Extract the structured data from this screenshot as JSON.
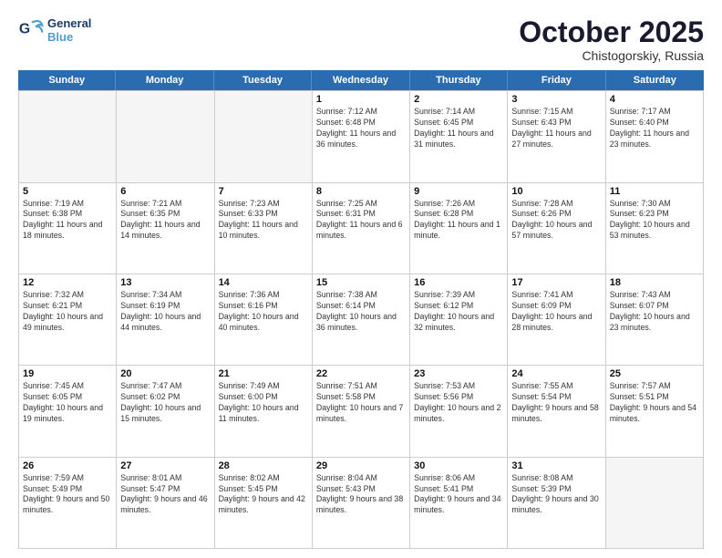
{
  "header": {
    "logo_line1": "General",
    "logo_line2": "Blue",
    "month": "October 2025",
    "location": "Chistogorskiy, Russia"
  },
  "days_of_week": [
    "Sunday",
    "Monday",
    "Tuesday",
    "Wednesday",
    "Thursday",
    "Friday",
    "Saturday"
  ],
  "weeks": [
    [
      {
        "day": "",
        "info": ""
      },
      {
        "day": "",
        "info": ""
      },
      {
        "day": "",
        "info": ""
      },
      {
        "day": "1",
        "info": "Sunrise: 7:12 AM\nSunset: 6:48 PM\nDaylight: 11 hours\nand 36 minutes."
      },
      {
        "day": "2",
        "info": "Sunrise: 7:14 AM\nSunset: 6:45 PM\nDaylight: 11 hours\nand 31 minutes."
      },
      {
        "day": "3",
        "info": "Sunrise: 7:15 AM\nSunset: 6:43 PM\nDaylight: 11 hours\nand 27 minutes."
      },
      {
        "day": "4",
        "info": "Sunrise: 7:17 AM\nSunset: 6:40 PM\nDaylight: 11 hours\nand 23 minutes."
      }
    ],
    [
      {
        "day": "5",
        "info": "Sunrise: 7:19 AM\nSunset: 6:38 PM\nDaylight: 11 hours\nand 18 minutes."
      },
      {
        "day": "6",
        "info": "Sunrise: 7:21 AM\nSunset: 6:35 PM\nDaylight: 11 hours\nand 14 minutes."
      },
      {
        "day": "7",
        "info": "Sunrise: 7:23 AM\nSunset: 6:33 PM\nDaylight: 11 hours\nand 10 minutes."
      },
      {
        "day": "8",
        "info": "Sunrise: 7:25 AM\nSunset: 6:31 PM\nDaylight: 11 hours\nand 6 minutes."
      },
      {
        "day": "9",
        "info": "Sunrise: 7:26 AM\nSunset: 6:28 PM\nDaylight: 11 hours\nand 1 minute."
      },
      {
        "day": "10",
        "info": "Sunrise: 7:28 AM\nSunset: 6:26 PM\nDaylight: 10 hours\nand 57 minutes."
      },
      {
        "day": "11",
        "info": "Sunrise: 7:30 AM\nSunset: 6:23 PM\nDaylight: 10 hours\nand 53 minutes."
      }
    ],
    [
      {
        "day": "12",
        "info": "Sunrise: 7:32 AM\nSunset: 6:21 PM\nDaylight: 10 hours\nand 49 minutes."
      },
      {
        "day": "13",
        "info": "Sunrise: 7:34 AM\nSunset: 6:19 PM\nDaylight: 10 hours\nand 44 minutes."
      },
      {
        "day": "14",
        "info": "Sunrise: 7:36 AM\nSunset: 6:16 PM\nDaylight: 10 hours\nand 40 minutes."
      },
      {
        "day": "15",
        "info": "Sunrise: 7:38 AM\nSunset: 6:14 PM\nDaylight: 10 hours\nand 36 minutes."
      },
      {
        "day": "16",
        "info": "Sunrise: 7:39 AM\nSunset: 6:12 PM\nDaylight: 10 hours\nand 32 minutes."
      },
      {
        "day": "17",
        "info": "Sunrise: 7:41 AM\nSunset: 6:09 PM\nDaylight: 10 hours\nand 28 minutes."
      },
      {
        "day": "18",
        "info": "Sunrise: 7:43 AM\nSunset: 6:07 PM\nDaylight: 10 hours\nand 23 minutes."
      }
    ],
    [
      {
        "day": "19",
        "info": "Sunrise: 7:45 AM\nSunset: 6:05 PM\nDaylight: 10 hours\nand 19 minutes."
      },
      {
        "day": "20",
        "info": "Sunrise: 7:47 AM\nSunset: 6:02 PM\nDaylight: 10 hours\nand 15 minutes."
      },
      {
        "day": "21",
        "info": "Sunrise: 7:49 AM\nSunset: 6:00 PM\nDaylight: 10 hours\nand 11 minutes."
      },
      {
        "day": "22",
        "info": "Sunrise: 7:51 AM\nSunset: 5:58 PM\nDaylight: 10 hours\nand 7 minutes."
      },
      {
        "day": "23",
        "info": "Sunrise: 7:53 AM\nSunset: 5:56 PM\nDaylight: 10 hours\nand 2 minutes."
      },
      {
        "day": "24",
        "info": "Sunrise: 7:55 AM\nSunset: 5:54 PM\nDaylight: 9 hours\nand 58 minutes."
      },
      {
        "day": "25",
        "info": "Sunrise: 7:57 AM\nSunset: 5:51 PM\nDaylight: 9 hours\nand 54 minutes."
      }
    ],
    [
      {
        "day": "26",
        "info": "Sunrise: 7:59 AM\nSunset: 5:49 PM\nDaylight: 9 hours\nand 50 minutes."
      },
      {
        "day": "27",
        "info": "Sunrise: 8:01 AM\nSunset: 5:47 PM\nDaylight: 9 hours\nand 46 minutes."
      },
      {
        "day": "28",
        "info": "Sunrise: 8:02 AM\nSunset: 5:45 PM\nDaylight: 9 hours\nand 42 minutes."
      },
      {
        "day": "29",
        "info": "Sunrise: 8:04 AM\nSunset: 5:43 PM\nDaylight: 9 hours\nand 38 minutes."
      },
      {
        "day": "30",
        "info": "Sunrise: 8:06 AM\nSunset: 5:41 PM\nDaylight: 9 hours\nand 34 minutes."
      },
      {
        "day": "31",
        "info": "Sunrise: 8:08 AM\nSunset: 5:39 PM\nDaylight: 9 hours\nand 30 minutes."
      },
      {
        "day": "",
        "info": ""
      }
    ]
  ]
}
